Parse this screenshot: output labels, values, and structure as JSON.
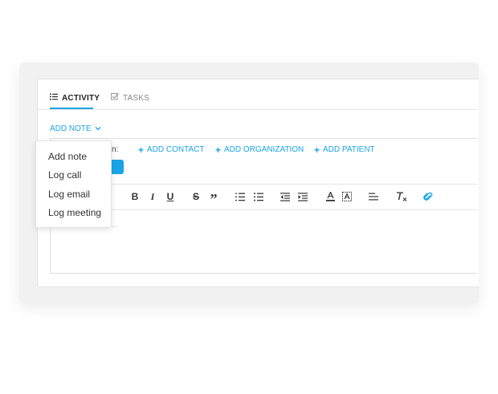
{
  "tabs": {
    "activity": {
      "label": "ACTIVITY",
      "icon": "list-icon",
      "active": true
    },
    "tasks": {
      "label": "TASKS",
      "icon": "checkbox-icon",
      "active": false
    }
  },
  "add_note": {
    "label": "ADD NOTE",
    "icon": "chevron-down-icon"
  },
  "associate": {
    "label_visible": "n:",
    "links": [
      {
        "label": "ADD CONTACT"
      },
      {
        "label": "ADD ORGANIZATION"
      },
      {
        "label": "ADD PATIENT"
      }
    ]
  },
  "dropdown_menu": {
    "items": [
      {
        "label": "Add note"
      },
      {
        "label": "Log call"
      },
      {
        "label": "Log email"
      },
      {
        "label": "Log meeting"
      }
    ]
  },
  "toolbar": {
    "buttons": [
      "bold",
      "italic",
      "underline",
      "strikethrough",
      "blockquote",
      "ordered-list",
      "bullet-list",
      "outdent",
      "indent",
      "font-color",
      "highlight",
      "align",
      "clear-format",
      "attach"
    ],
    "bold_glyph": "B",
    "italic_glyph": "I",
    "underline_glyph": "U",
    "strike_glyph": "S",
    "quote_glyph": "”"
  },
  "editor": {
    "placeholder_visible": "..."
  },
  "colors": {
    "accent": "#1aa4e8",
    "text": "#333333",
    "border": "#e4e4e4"
  }
}
